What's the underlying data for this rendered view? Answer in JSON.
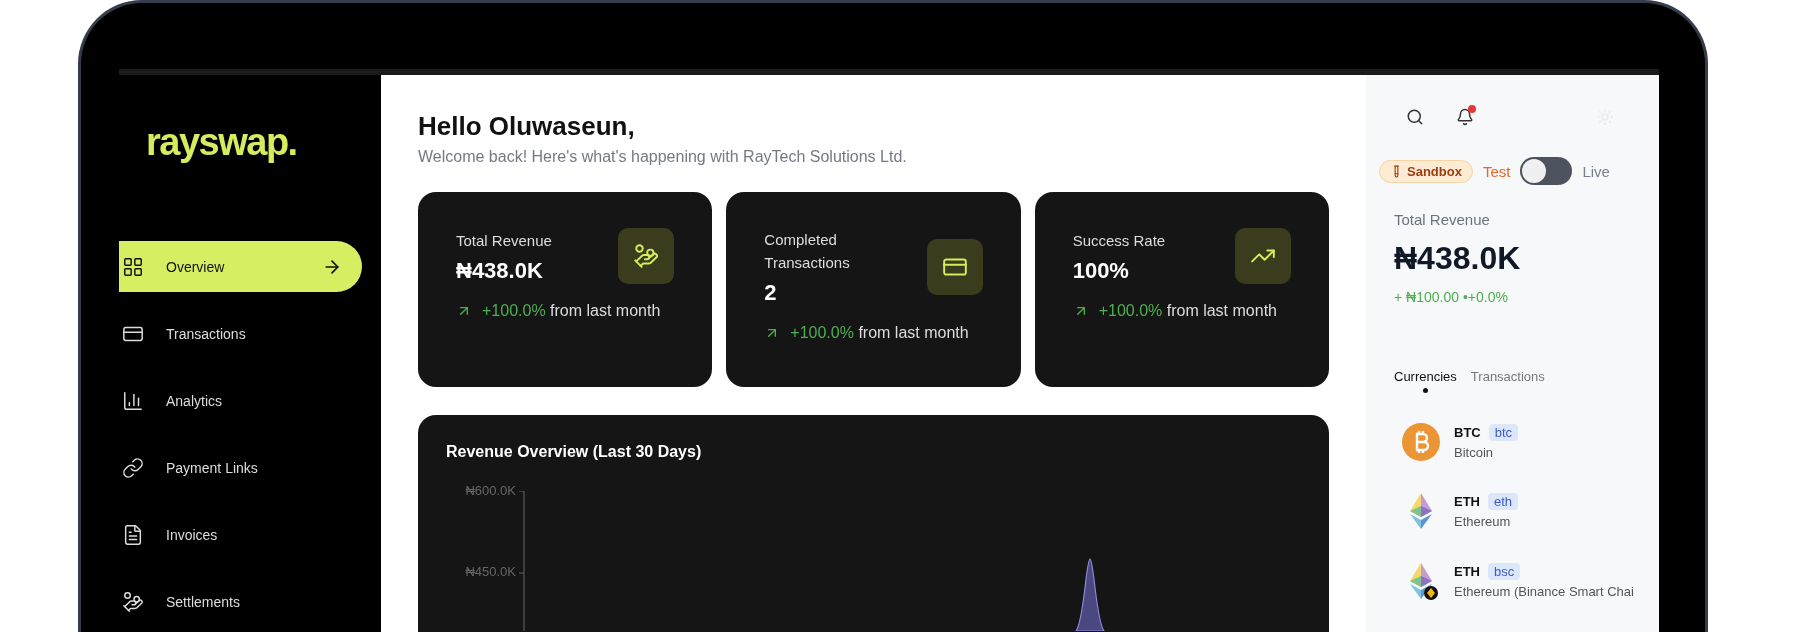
{
  "sidebar": {
    "logo": "rayswap.",
    "items": [
      {
        "label": "Overview",
        "selected": true
      },
      {
        "label": "Transactions",
        "selected": false
      },
      {
        "label": "Analytics",
        "selected": false
      },
      {
        "label": "Payment Links",
        "selected": false
      },
      {
        "label": "Invoices",
        "selected": false
      },
      {
        "label": "Settlements",
        "selected": false
      }
    ]
  },
  "main": {
    "greeting": "Hello Oluwaseun,",
    "subtitle": "Welcome back! Here's what's happening with RayTech Solutions Ltd.",
    "cards": [
      {
        "label": "Total Revenue",
        "value": "₦438.0K",
        "change": "+100.0%",
        "change_note": "from last month"
      },
      {
        "label": "Completed Transactions",
        "value": "2",
        "change": "+100.0%",
        "change_note": "from last month"
      },
      {
        "label": "Success Rate",
        "value": "100%",
        "change": "+100.0%",
        "change_note": "from last month"
      }
    ],
    "revenue_chart": {
      "title": "Revenue Overview (Last 30 Days)",
      "y_tick_labels": [
        "₦600.0K",
        "₦450.0K"
      ]
    }
  },
  "right_panel": {
    "notifications_unread": true,
    "sandbox_badge": "Sandbox",
    "mode_left": "Test",
    "mode_right": "Live",
    "live": false,
    "revenue_label": "Total Revenue",
    "revenue_value": "₦438.0K",
    "revenue_change": "+ ₦100.00 •+0.0%",
    "tabs": [
      {
        "label": "Currencies",
        "selected": true
      },
      {
        "label": "Transactions",
        "selected": false
      }
    ],
    "currencies": [
      {
        "kind": "bitcoin",
        "symbol": "BTC",
        "tag": "btc",
        "name": "Bitcoin"
      },
      {
        "kind": "ethereum",
        "symbol": "ETH",
        "tag": "eth",
        "name": "Ethereum"
      },
      {
        "kind": "ethereum-bsc",
        "symbol": "ETH",
        "tag": "bsc",
        "name": "Ethereum (Binance Smart Chai"
      }
    ]
  }
}
